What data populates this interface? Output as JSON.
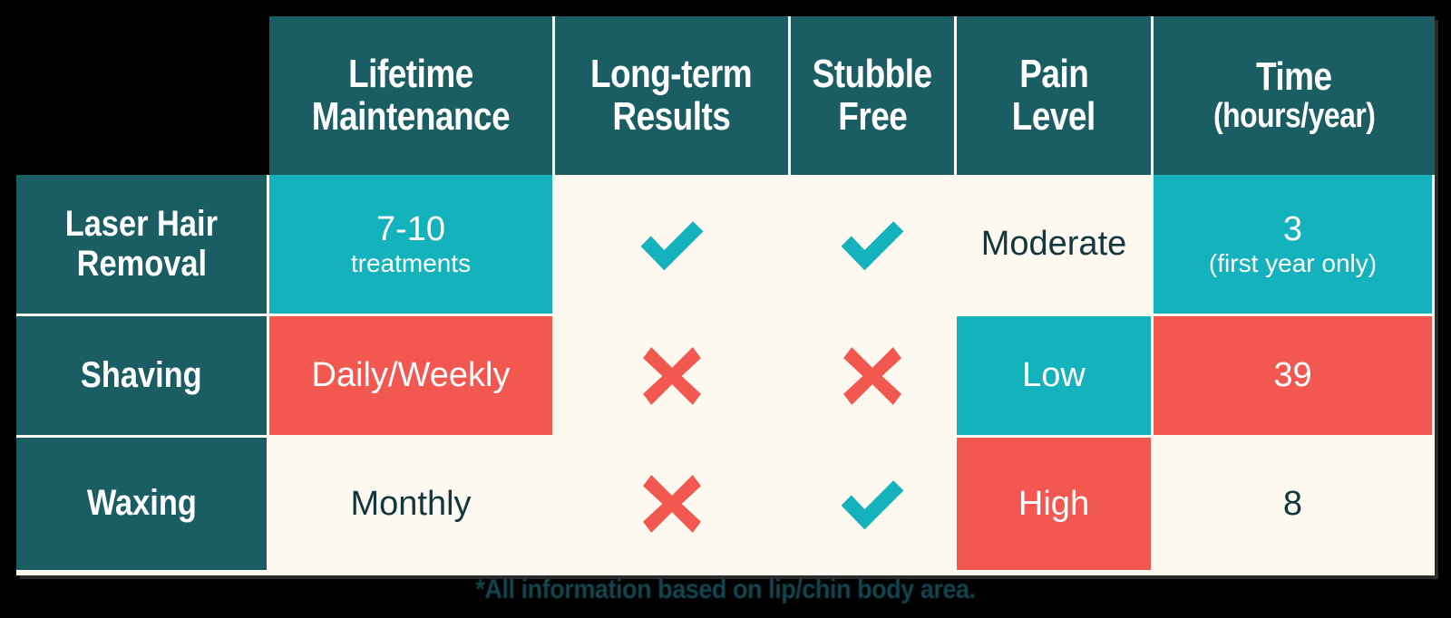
{
  "colors": {
    "dark_teal": "#1A5D63",
    "bright_teal": "#14B2BC",
    "red": "#F25750",
    "cream": "#FDF8F0",
    "text_dark": "#14373D",
    "text_light": "#FFFFFF",
    "page_background": "#000000"
  },
  "table": {
    "corner_label": "",
    "headers": [
      {
        "line1": "Lifetime",
        "line2": "Maintenance"
      },
      {
        "line1": "Long-term",
        "line2": "Results"
      },
      {
        "line1": "Stubble",
        "line2": "Free"
      },
      {
        "line1": "Pain",
        "line2": "Level"
      },
      {
        "line1": "Time",
        "line2": "(hours/year)"
      }
    ],
    "rows": [
      {
        "label_line1": "Laser Hair",
        "label_line2": "Removal",
        "maintenance_main": "7-10",
        "maintenance_sub": "treatments",
        "long_term_results": "check-icon",
        "stubble_free": "check-icon",
        "pain_level": "Moderate",
        "time_main": "3",
        "time_sub": "(first year only)"
      },
      {
        "label_line1": "Shaving",
        "label_line2": "",
        "maintenance_main": "Daily/Weekly",
        "maintenance_sub": "",
        "long_term_results": "cross-icon",
        "stubble_free": "cross-icon",
        "pain_level": "Low",
        "time_main": "39",
        "time_sub": ""
      },
      {
        "label_line1": "Waxing",
        "label_line2": "",
        "maintenance_main": "Monthly",
        "maintenance_sub": "",
        "long_term_results": "cross-icon",
        "stubble_free": "check-icon",
        "pain_level": "High",
        "time_main": "8",
        "time_sub": ""
      }
    ]
  },
  "footnote": "*All information based on lip/chin body area."
}
